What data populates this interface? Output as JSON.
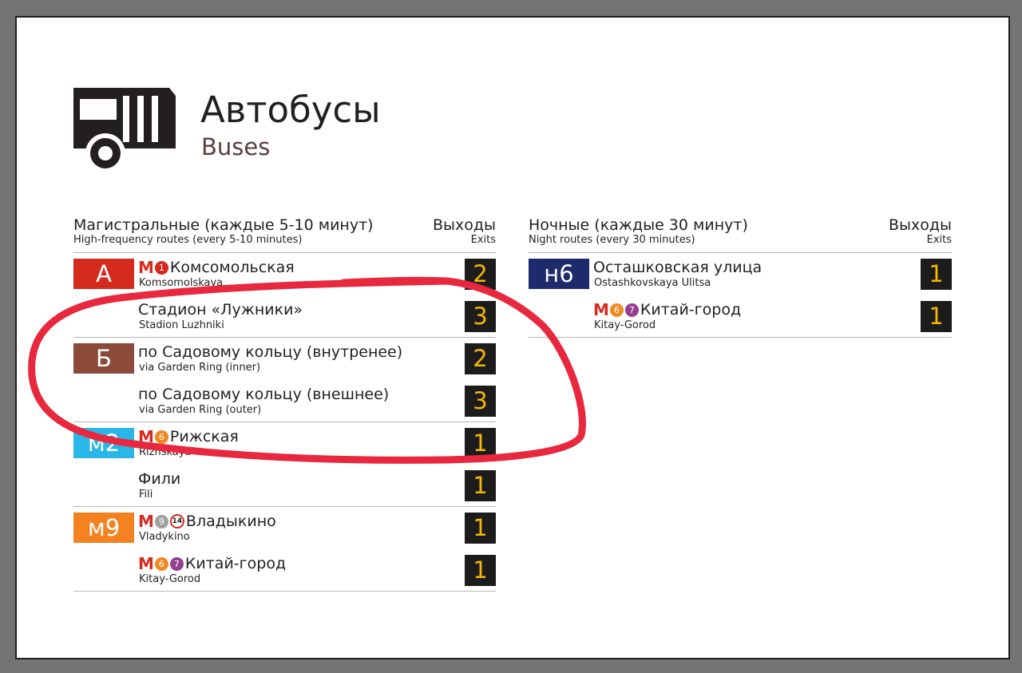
{
  "colors": {
    "exit_digit": "#f5b700",
    "exit_bg": "#1c1c1c",
    "metro_red": "#d52b1e",
    "highlight": "#e8283f"
  },
  "header": {
    "icon": "bus-icon",
    "title_ru": "Автобусы",
    "title_en": "Buses"
  },
  "sections": [
    {
      "title_ru": "Магистральные (каждые 5-10 минут)",
      "title_en": "High-frequency routes (every 5-10 minutes)",
      "exits_ru": "Выходы",
      "exits_en": "Exits",
      "rows": [
        {
          "route": "А",
          "color": "#d52b1e",
          "metro": true,
          "lines": [
            {
              "num": "1",
              "color": "#d52b1e"
            }
          ],
          "stop_ru": "Комсомольская",
          "stop_en": "Komsomolskaya",
          "exit": "2"
        },
        {
          "route": "",
          "metro": false,
          "lines": [],
          "stop_ru": "Стадион «Лужники»",
          "stop_en": "Stadion Luzhniki",
          "exit": "3"
        },
        {
          "route": "Б",
          "color": "#8b4a3a",
          "metro": false,
          "lines": [],
          "stop_ru": "по Садовому кольцу (внутренее)",
          "stop_en": "via Garden Ring (inner)",
          "exit": "2"
        },
        {
          "route": "",
          "metro": false,
          "lines": [],
          "stop_ru": "по Садовому кольцу (внешнее)",
          "stop_en": "via Garden Ring (outer)",
          "exit": "3"
        },
        {
          "route": "м2",
          "color": "#29b6e8",
          "metro": true,
          "lines": [
            {
              "num": "6",
              "color": "#f08a24"
            }
          ],
          "stop_ru": "Рижская",
          "stop_en": "Rizhskaya",
          "exit": "1"
        },
        {
          "route": "",
          "metro": false,
          "lines": [],
          "stop_ru": "Фили",
          "stop_en": "Fili",
          "exit": "1"
        },
        {
          "route": "м9",
          "color": "#f58220",
          "metro": true,
          "lines": [
            {
              "num": "9",
              "color": "#a0a0a0"
            },
            {
              "num": "14",
              "color": "ring"
            }
          ],
          "stop_ru": "Владыкино",
          "stop_en": "Vladykino",
          "exit": "1"
        },
        {
          "route": "",
          "metro": true,
          "lines": [
            {
              "num": "6",
              "color": "#f08a24"
            },
            {
              "num": "7",
              "color": "#943e90"
            }
          ],
          "stop_ru": "Китай-город",
          "stop_en": "Kitay-Gorod",
          "exit": "1"
        }
      ]
    },
    {
      "title_ru": "Ночные (каждые 30 минут)",
      "title_en": "Night routes (every 30 minutes)",
      "exits_ru": "Выходы",
      "exits_en": "Exits",
      "rows": [
        {
          "route": "н6",
          "color": "#1d2a6b",
          "strip": "#f08a24",
          "metro": false,
          "lines": [],
          "stop_ru": "Осташковская улица",
          "stop_en": "Ostashkovskaya Ulitsa",
          "exit": "1"
        },
        {
          "route": "",
          "metro": true,
          "lines": [
            {
              "num": "6",
              "color": "#f08a24"
            },
            {
              "num": "7",
              "color": "#943e90"
            }
          ],
          "stop_ru": "Китай-город",
          "stop_en": "Kitay-Gorod",
          "exit": "1"
        }
      ]
    }
  ]
}
